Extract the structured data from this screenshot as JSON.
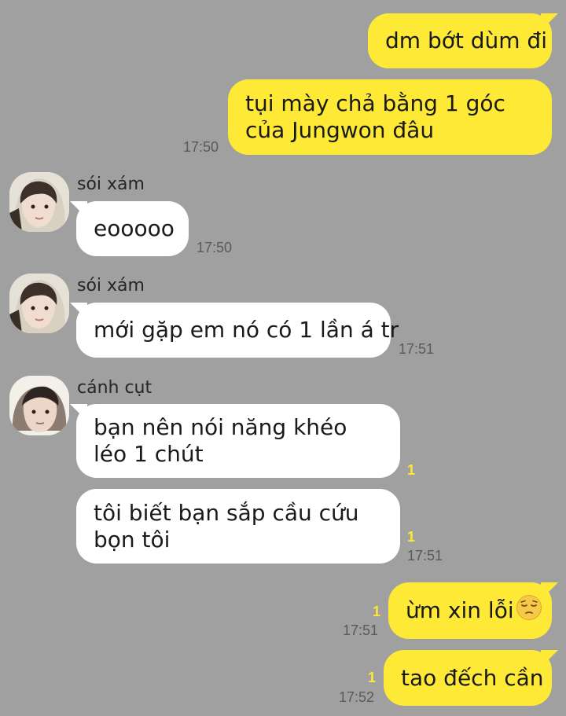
{
  "messages": {
    "m1": {
      "text": "dm bớt dùm đi"
    },
    "m2": {
      "text": "tụi mày chả bằng 1 góc của Jungwon đâu",
      "time": "17:50"
    },
    "m3": {
      "sender": "sói xám",
      "text": "eooooo",
      "time": "17:50"
    },
    "m4": {
      "sender": "sói xám",
      "text": "mới gặp em nó có 1 lần á tr",
      "time": "17:51"
    },
    "m5": {
      "sender": "cánh cụt",
      "text": "bạn nên nói năng khéo léo 1 chút",
      "unread": "1"
    },
    "m6": {
      "text": "tôi biết bạn sắp cầu cứu bọn tôi",
      "unread": "1",
      "time": "17:51"
    },
    "m7": {
      "text": "ừm xin lỗi",
      "emoji": "pensive-face-icon",
      "unread": "1",
      "time": "17:51"
    },
    "m8": {
      "text": "tao đếch cần",
      "unread": "1",
      "time": "17:52"
    }
  },
  "colors": {
    "background": "#a0a0a0",
    "my_bubble": "#fee936",
    "their_bubble": "#ffffff",
    "unread_count": "#fee936"
  }
}
